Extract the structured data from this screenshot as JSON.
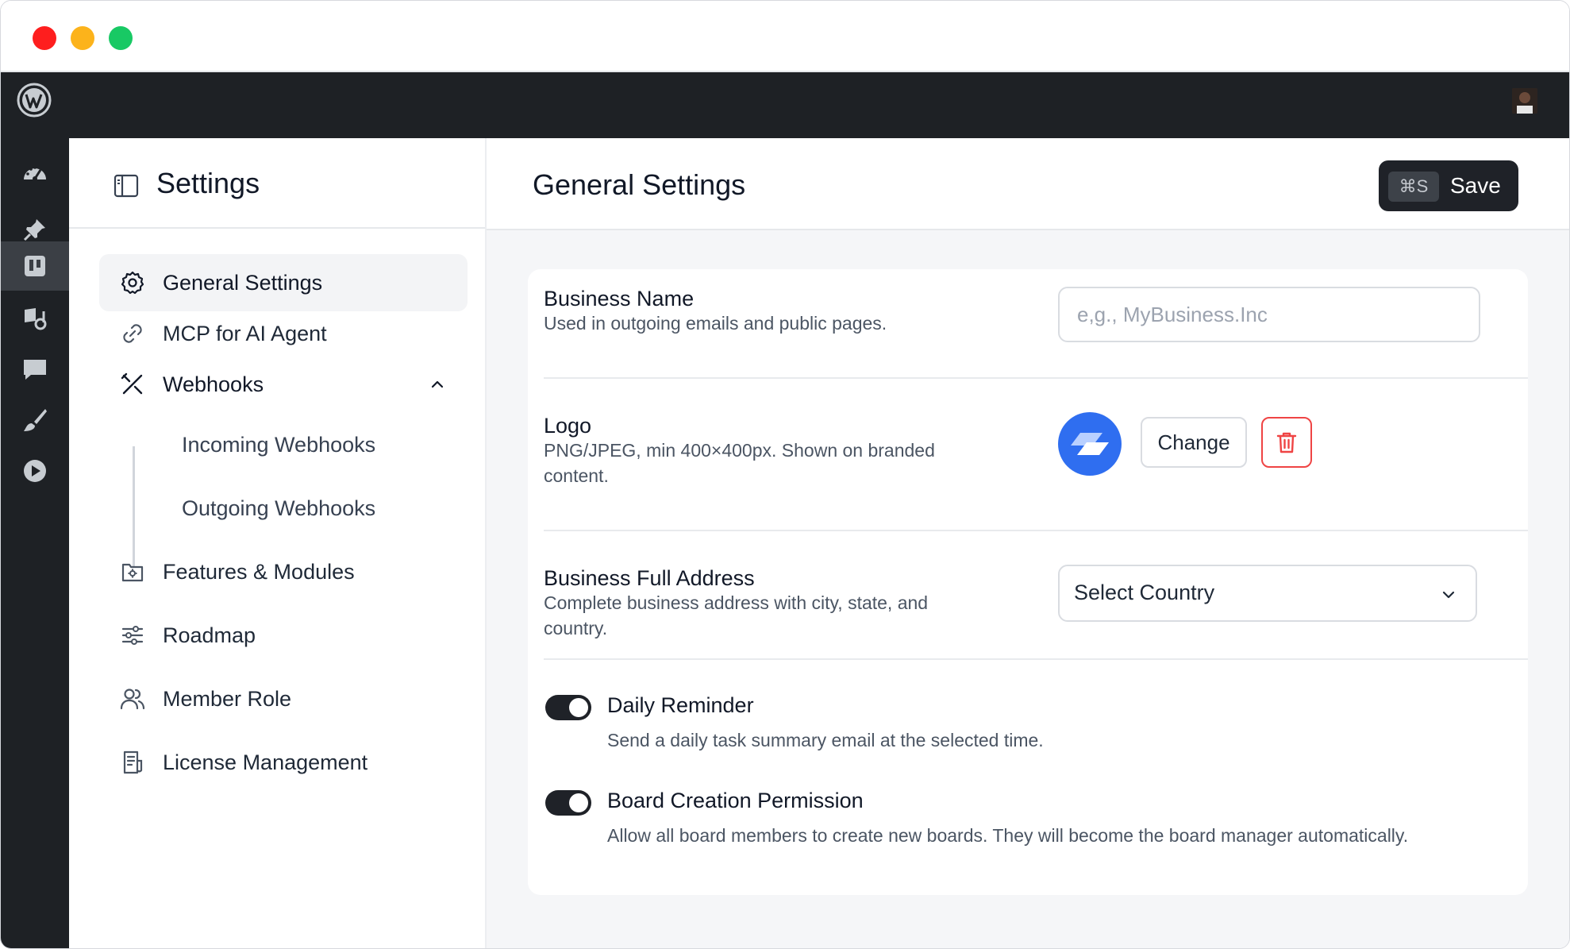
{
  "window": {
    "controls": [
      "close",
      "minimize",
      "maximize"
    ]
  },
  "adminbar": {
    "logo_icon": "wordpress-icon",
    "avatar_icon": "user-avatar"
  },
  "leftbar": {
    "items": [
      {
        "icon": "dashboard-icon"
      },
      {
        "icon": "pin-icon"
      },
      {
        "icon": "board-icon",
        "active": true
      },
      {
        "icon": "media-icon"
      },
      {
        "icon": "comment-icon"
      },
      {
        "icon": "brush-icon"
      },
      {
        "icon": "play-icon"
      }
    ]
  },
  "sidebar": {
    "title": "Settings",
    "items": [
      {
        "label": "General Settings",
        "icon": "gear-icon",
        "active": true
      },
      {
        "label": "MCP for AI Agent",
        "icon": "link-icon"
      },
      {
        "label": "Webhooks",
        "icon": "tools-icon",
        "expanded": true
      },
      {
        "label": "Incoming Webhooks"
      },
      {
        "label": "Outgoing Webhooks"
      },
      {
        "label": "Features & Modules",
        "icon": "folder-gear-icon"
      },
      {
        "label": "Roadmap",
        "icon": "sliders-icon"
      },
      {
        "label": "Member Role",
        "icon": "users-icon"
      },
      {
        "label": "License Management",
        "icon": "document-icon"
      }
    ]
  },
  "header": {
    "title": "General Settings",
    "save_shortcut": "⌘S",
    "save_label": "Save"
  },
  "form": {
    "business_name": {
      "title": "Business Name",
      "description": "Used in outgoing emails and public pages.",
      "placeholder": "e,g., MyBusiness.Inc",
      "value": ""
    },
    "logo": {
      "title": "Logo",
      "description": "PNG/JPEG, min 400×400px. Shown on branded content.",
      "change_label": "Change",
      "delete_icon": "trash-icon",
      "color": "#2f6ef0"
    },
    "address": {
      "title": "Business Full Address",
      "description": "Complete business address with city, state, and country.",
      "country_select": "Select Country"
    },
    "daily_reminder": {
      "title": "Daily Reminder",
      "description": "Send a daily task summary email at the selected time.",
      "enabled": true
    },
    "board_creation": {
      "title": "Board Creation Permission",
      "description": "Allow all board members to create new boards. They will become the board manager automatically.",
      "enabled": true
    }
  },
  "colors": {
    "dark": "#1e2125",
    "accent": "#1f2228",
    "danger": "#ef4444"
  }
}
